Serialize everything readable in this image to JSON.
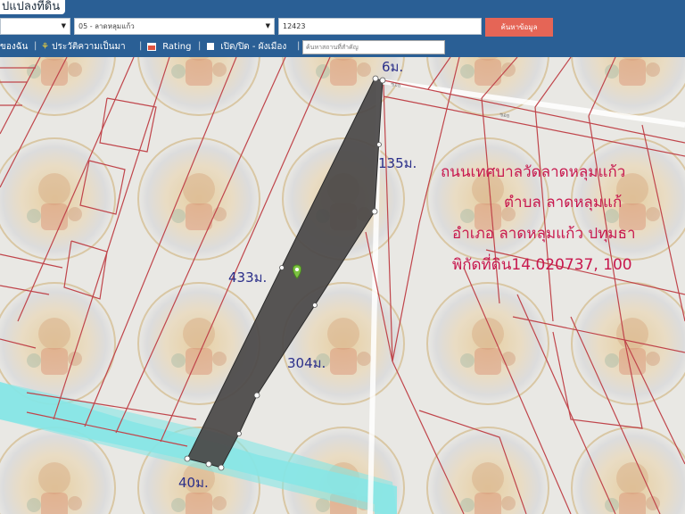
{
  "header": {
    "title": "ปแปลงที่ดิน",
    "left_select": "",
    "tambon_select": "05 - ลาดหลุมแก้ว",
    "parcel_number": "12423",
    "search_button": "ค้นหาข้อมูล"
  },
  "toolbar": {
    "item1": "ของฉัน",
    "item2": "ประวัติความเป็นมา",
    "item3": "Rating",
    "item4": "เปิด/ปิด - ผังเมือง",
    "place_placeholder": "ค้นหาสถานที่สำคัญ"
  },
  "map": {
    "dimensions": {
      "top": "6ม.",
      "right_upper": "135ม.",
      "left": "433ม.",
      "right_lower": "304ม.",
      "bottom": "40ม."
    },
    "annotations": {
      "road": "ถนนเทศบาลวัดลาดหลุมแก้ว",
      "tambon": "ตำบล ลาดหลุมแก้",
      "amphoe": "อำเภอ ลาดหลุมแก้ว ปทุมธา",
      "coords": "พิกัดที่ดิน14.020737, 100"
    },
    "colors": {
      "parcel_fill": "#4a4848",
      "parcel_lines": "#c0454b",
      "canal": "#86e6e6",
      "header": "#2a5f95",
      "annotation_text": "#c8184e",
      "dimension_text": "#2b2f8a"
    }
  }
}
